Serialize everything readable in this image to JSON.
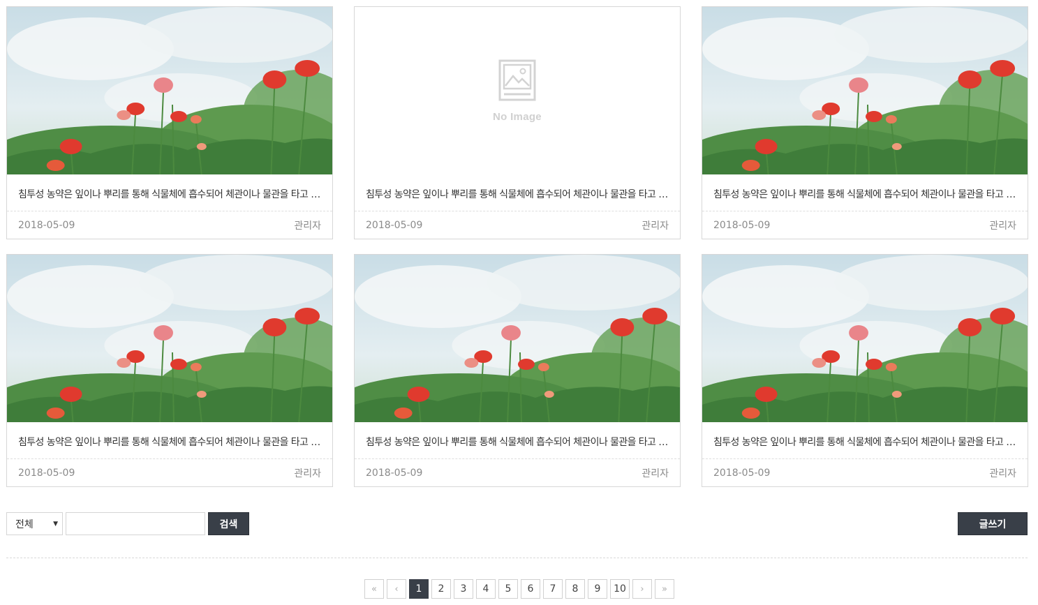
{
  "posts": [
    {
      "title": "침투성 농약은 잎이나 뿌리를 통해 식물체에 흡수되어 체관이나 물관을 타고 이동하는 농약",
      "date": "2018-05-09",
      "author": "관리자",
      "has_image": true
    },
    {
      "title": "침투성 농약은 잎이나 뿌리를 통해 식물체에 흡수되어 체관이나 물관을 타고 이동하는 농약",
      "date": "2018-05-09",
      "author": "관리자",
      "has_image": false,
      "placeholder": "No Image"
    },
    {
      "title": "침투성 농약은 잎이나 뿌리를 통해 식물체에 흡수되어 체관이나 물관을 타고 이동하는 농약",
      "date": "2018-05-09",
      "author": "관리자",
      "has_image": true
    },
    {
      "title": "침투성 농약은 잎이나 뿌리를 통해 식물체에 흡수되어 체관이나 물관을 타고 이동하는 농약",
      "date": "2018-05-09",
      "author": "관리자",
      "has_image": true
    },
    {
      "title": "침투성 농약은 잎이나 뿌리를 통해 식물체에 흡수되어 체관이나 물관을 타고 이동하는 농약",
      "date": "2018-05-09",
      "author": "관리자",
      "has_image": true
    },
    {
      "title": "침투성 농약은 잎이나 뿌리를 통해 식물체에 흡수되어 체관이나 물관을 타고 이동하는 농약",
      "date": "2018-05-09",
      "author": "관리자",
      "has_image": true
    }
  ],
  "search": {
    "category_selected": "전체",
    "input_value": "",
    "button_label": "검색"
  },
  "write_button_label": "글쓰기",
  "pagination": {
    "first": "«",
    "prev": "‹",
    "next": "›",
    "last": "»",
    "pages": [
      "1",
      "2",
      "3",
      "4",
      "5",
      "6",
      "7",
      "8",
      "9",
      "10"
    ],
    "current": "1"
  },
  "colors": {
    "dark_button": "#393f48",
    "border": "#d7d7d7"
  },
  "icons": {
    "no_image": "image-placeholder-icon",
    "select_arrow": "caret-down-icon"
  }
}
